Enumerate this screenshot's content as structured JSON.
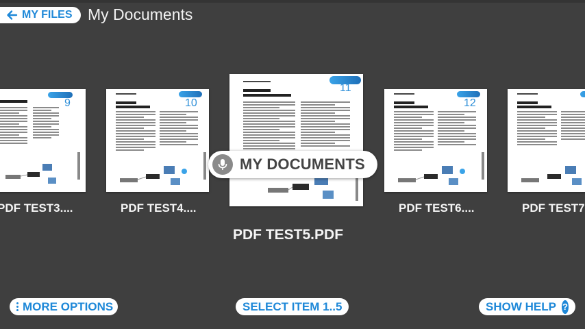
{
  "header": {
    "back_label": "MY FILES",
    "title": "My Documents"
  },
  "documents": [
    {
      "number": "9",
      "name": "PDF TEST3...."
    },
    {
      "number": "10",
      "name": "PDF TEST4...."
    },
    {
      "number": "11",
      "name": "PDF TEST5.PDF"
    },
    {
      "number": "12",
      "name": "PDF TEST6...."
    },
    {
      "number": "",
      "name": "PDF TEST7"
    }
  ],
  "overlay": {
    "label": "MY DOCUMENTS"
  },
  "footer": {
    "more_options": "MORE OPTIONS",
    "select_item": "SELECT ITEM 1..5",
    "show_help": "SHOW HELP",
    "help_glyph": "?"
  },
  "colors": {
    "accent": "#1e88d8",
    "background": "#3f3f3f"
  }
}
